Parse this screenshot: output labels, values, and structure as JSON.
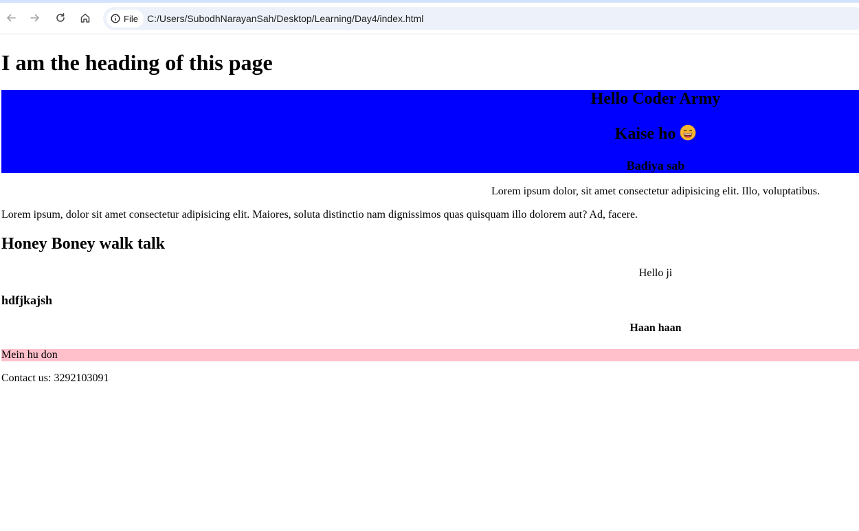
{
  "browser": {
    "site_chip_label": "File",
    "url": "C:/Users/SubodhNarayanSah/Desktop/Learning/Day4/index.html",
    "icons": [
      "back-icon",
      "forward-icon",
      "reload-icon",
      "home-icon",
      "info-icon"
    ]
  },
  "page": {
    "heading": "I am the heading of this page",
    "blue_section": {
      "title": "Hello Coder Army",
      "subtitle": "Kaise ho",
      "emoji_icon": "grinning-face-emoji",
      "tagline": "Badiya sab",
      "background": "#0000ff"
    },
    "lorem_right": "Lorem ipsum dolor, sit amet consectetur adipisicing elit. Illo, voluptatibus.",
    "lorem_full": "Lorem ipsum, dolor sit amet consectetur adipisicing elit. Maiores, soluta distinctio nam dignissimos quas quisquam illo dolorem aut? Ad, facere.",
    "honey_heading": "Honey Boney walk talk",
    "hello_text": "Hello ji",
    "hdf_heading": "hdfjkajsh",
    "haan_text": "Haan haan",
    "pink_bar": {
      "text": "Mein hu don",
      "background": "#ffc0cb"
    },
    "contact": "Contact us: 3292103091"
  }
}
